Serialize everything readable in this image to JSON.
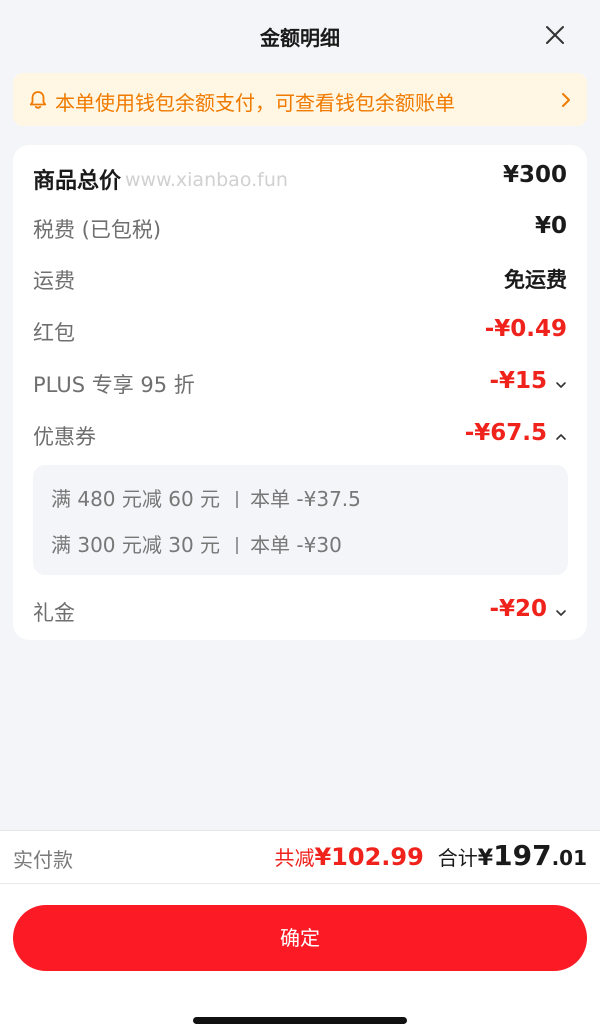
{
  "header": {
    "title": "金额明细"
  },
  "notice": {
    "text": "本单使用钱包余额支付，可查看钱包余额账单"
  },
  "watermark": "www.xianbao.fun",
  "rows": {
    "goods_total": {
      "label": "商品总价",
      "value": "¥300"
    },
    "tax": {
      "label": "税费 (已包税)",
      "value": "¥0"
    },
    "shipping": {
      "label": "运费",
      "value": "免运费"
    },
    "red_packet": {
      "label": "红包",
      "value": "-¥0.49"
    },
    "plus": {
      "label": "PLUS 专享 95 折",
      "value": "-¥15"
    },
    "coupon": {
      "label": "优惠券",
      "value": "-¥67.5"
    },
    "gift": {
      "label": "礼金",
      "value": "-¥20"
    }
  },
  "coupons": [
    {
      "condition": "满 480 元减 60 元",
      "amount": "本单 -¥37.5"
    },
    {
      "condition": "满 300 元减 30 元",
      "amount": "本单 -¥30"
    }
  ],
  "payment": {
    "label": "实付款",
    "saved_prefix": "共减",
    "saved_amount": "¥102.99",
    "total_prefix": "合计",
    "total_yen": "¥",
    "total_int": "197",
    "total_dec": ".01"
  },
  "confirm_label": "确定",
  "colors": {
    "accent_red": "#f0221c",
    "button_red": "#fc1a24",
    "notice_orange": "#f07a00",
    "notice_bg": "#fff7e3"
  }
}
